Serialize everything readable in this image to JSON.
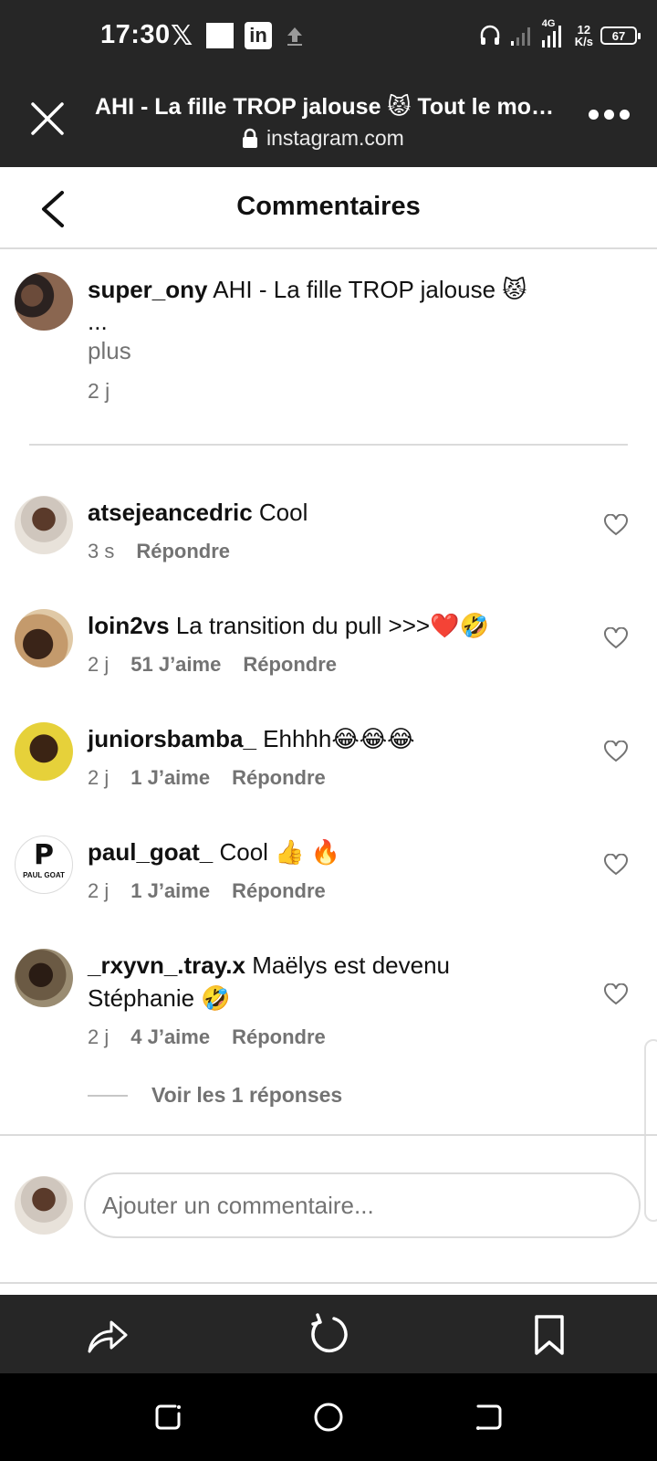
{
  "status": {
    "time": "17:30",
    "network": "4G",
    "speed_value": "12",
    "speed_unit": "K/s",
    "battery": "67"
  },
  "browser": {
    "title": "AHI - La fille TROP jalouse 😾 Tout le mon...",
    "url": "instagram.com"
  },
  "header": {
    "title": "Commentaires"
  },
  "caption": {
    "username": "super_ony",
    "text": "AHI - La fille TROP jalouse 😾",
    "ellipsis": "...",
    "more": "plus",
    "time": "2 j"
  },
  "comments": [
    {
      "username": "atsejeancedric",
      "text": "Cool",
      "time": "3 s",
      "likes": "",
      "reply": "Répondre"
    },
    {
      "username": "loin2vs",
      "text": "La transition du pull >>>❤️🤣",
      "time": "2 j",
      "likes": "51 J’aime",
      "reply": "Répondre"
    },
    {
      "username": "juniorsbamba_",
      "text": "Ehhhh😂😂😂",
      "time": "2 j",
      "likes": "1 J’aime",
      "reply": "Répondre"
    },
    {
      "username": "paul_goat_",
      "text": "Cool 👍 🔥",
      "time": "2 j",
      "likes": "1 J’aime",
      "reply": "Répondre",
      "avatar_text": "PAUL GOAT"
    },
    {
      "username": "_rxyvn_.tray.x",
      "text": "Maëlys est devenu Stéphanie 🤣",
      "time": "2 j",
      "likes": "4 J’aime",
      "reply": "Répondre"
    }
  ],
  "replies_link": "Voir les 1 réponses",
  "composer": {
    "placeholder": "Ajouter un commentaire..."
  },
  "colors": {
    "dark_bar": "#262626",
    "secondary_text": "#737373",
    "divider": "#dbdbdb"
  }
}
